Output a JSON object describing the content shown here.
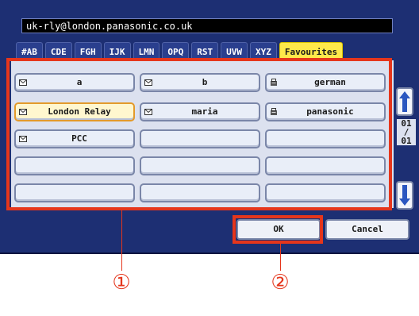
{
  "address_field": {
    "value": "uk-rly@london.panasonic.co.uk"
  },
  "tabs": [
    {
      "label": "#AB"
    },
    {
      "label": "CDE"
    },
    {
      "label": "FGH"
    },
    {
      "label": "IJK"
    },
    {
      "label": "LMN"
    },
    {
      "label": "OPQ"
    },
    {
      "label": "RST"
    },
    {
      "label": "UVW"
    },
    {
      "label": "XYZ"
    },
    {
      "label": "Favourites",
      "active": true
    }
  ],
  "entries": [
    {
      "label": "a",
      "icon": "envelope-icon"
    },
    {
      "label": "b",
      "icon": "envelope-icon"
    },
    {
      "label": "german",
      "icon": "fax-icon"
    },
    {
      "label": "London Relay",
      "icon": "envelope-icon",
      "selected": true
    },
    {
      "label": "maria",
      "icon": "envelope-icon"
    },
    {
      "label": "panasonic",
      "icon": "fax-icon"
    },
    {
      "label": "PCC",
      "icon": "envelope-icon"
    },
    {
      "label": ""
    },
    {
      "label": ""
    },
    {
      "label": ""
    },
    {
      "label": ""
    },
    {
      "label": ""
    },
    {
      "label": ""
    },
    {
      "label": ""
    },
    {
      "label": ""
    }
  ],
  "pagination": {
    "current": "01",
    "separator": "/",
    "total": "01"
  },
  "buttons": {
    "ok": "OK",
    "cancel": "Cancel"
  },
  "callouts": {
    "one": "①",
    "two": "②"
  },
  "colors": {
    "screen_bg": "#1d2f73",
    "highlight": "#e5361c",
    "active_tab": "#ffe94a"
  }
}
